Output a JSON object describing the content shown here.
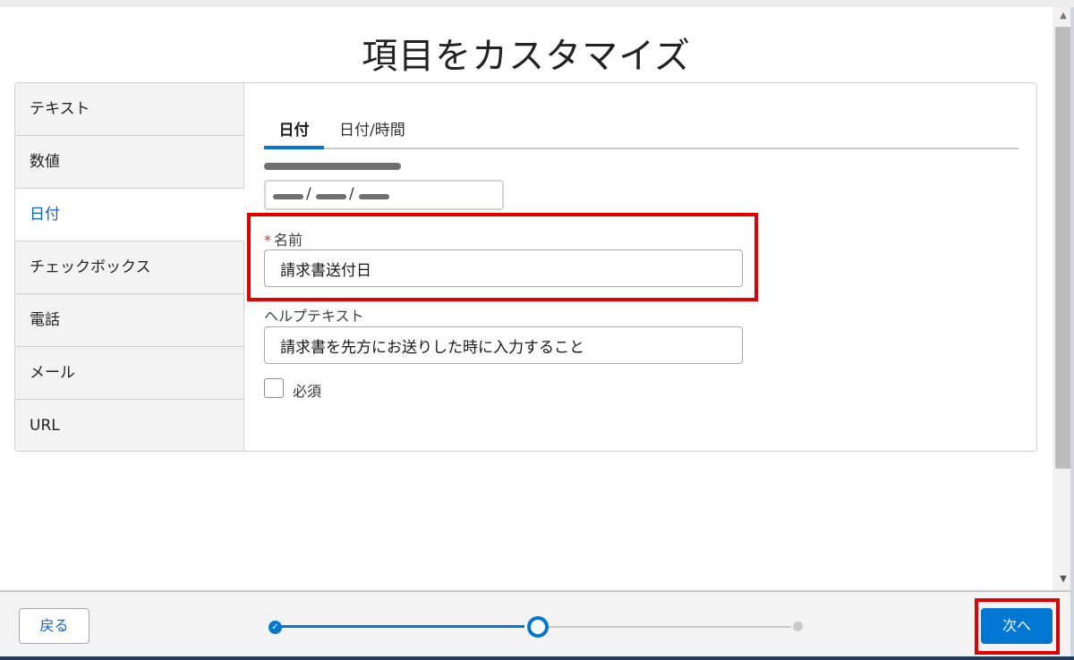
{
  "header": {
    "title": "項目をカスタマイズ"
  },
  "sidebar": {
    "items": [
      {
        "label": "テキスト"
      },
      {
        "label": "数値"
      },
      {
        "label": "日付",
        "active": true
      },
      {
        "label": "チェックボックス"
      },
      {
        "label": "電話"
      },
      {
        "label": "メール"
      },
      {
        "label": "URL"
      }
    ]
  },
  "tabs": [
    {
      "label": "日付",
      "selected": true
    },
    {
      "label": "日付/時間",
      "selected": false
    }
  ],
  "date_preview": {
    "separator": "/"
  },
  "form": {
    "name": {
      "required_mark": "*",
      "label": "名前",
      "value": "請求書送付日"
    },
    "help": {
      "label": "ヘルプテキスト",
      "value": "請求書を先方にお送りした時に入力すること"
    },
    "required_checkbox": {
      "label": "必須",
      "checked": false
    }
  },
  "footer": {
    "back_label": "戻る",
    "next_label": "次へ",
    "progress": {
      "current_step": 2,
      "total_steps": 3
    }
  },
  "colors": {
    "accent": "#0176d3",
    "highlight": "#e40000"
  }
}
